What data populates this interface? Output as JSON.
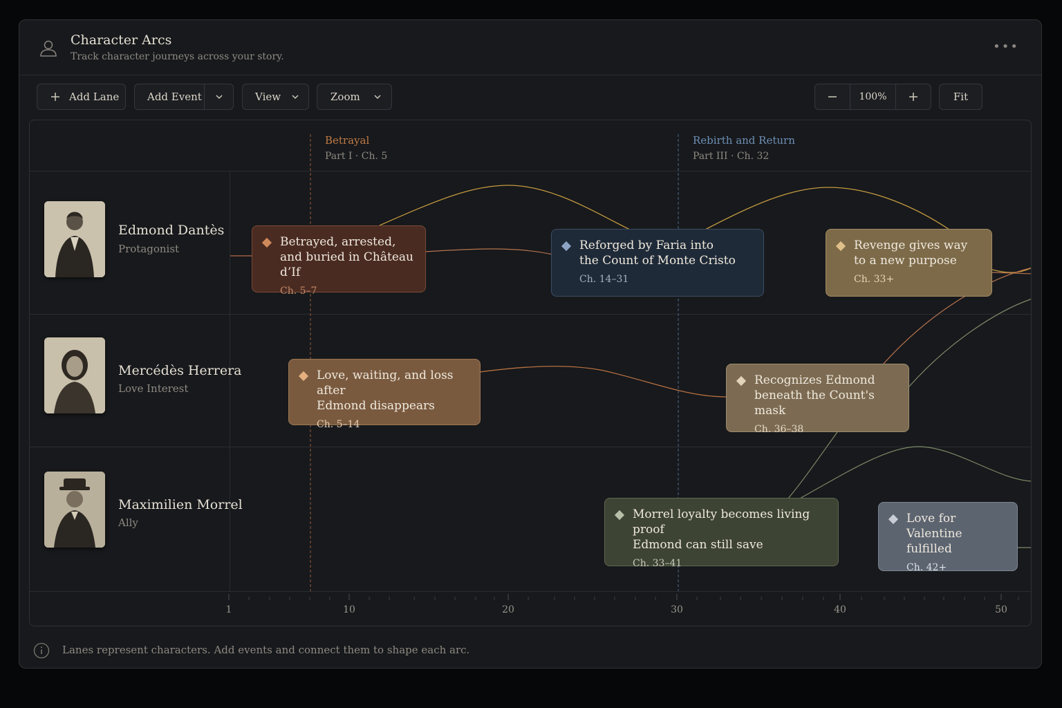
{
  "header": {
    "title": "Character Arcs",
    "subtitle": "Track character journeys across your story.",
    "more_icon": "more-horizontal-icon"
  },
  "toolbar": {
    "add_lane": "Add Lane",
    "add_event": "Add Event",
    "view": "View",
    "zoom": "Zoom",
    "zoom_level": "100%",
    "fit": "Fit"
  },
  "milestones": [
    {
      "title": "Betrayal",
      "subtitle": "Part I · Ch. 5",
      "chapter": 5,
      "color": "#c07a45"
    },
    {
      "title": "Rebirth and Return",
      "subtitle": "Part III · Ch. 32",
      "chapter": 32,
      "color": "#6f8fb5"
    }
  ],
  "lanes": [
    {
      "name": "Edmond Dantès",
      "role": "Protagonist"
    },
    {
      "name": "Mercédès Herrera",
      "role": "Love Interest"
    },
    {
      "name": "Maximilien Morrel",
      "role": "Ally"
    }
  ],
  "events": [
    {
      "line1": "Betrayed, arrested,",
      "line2": "and buried in Château d’If",
      "chapters": "Ch. 5–7",
      "bg": "#4a2b22",
      "border": "#7a4a36",
      "diamond": "#d08a5a",
      "chcolor": "#c58a66"
    },
    {
      "line1": "Reforged by Faria into",
      "line2": "the Count of Monte Cristo",
      "chapters": "Ch. 14–31",
      "bg": "#1f2a38",
      "border": "#3c4d63",
      "diamond": "#8ea4c4",
      "chcolor": "#a6b0bf"
    },
    {
      "line1": "Revenge gives way",
      "line2": "to a new purpose",
      "chapters": "Ch. 33+",
      "bg": "#7d6a49",
      "border": "#a38c62",
      "diamond": "#e0c08a",
      "chcolor": "#e6d6b8"
    },
    {
      "line1": "Love, waiting, and loss after",
      "line2": "Edmond disappears",
      "chapters": "Ch. 5–14",
      "bg": "#7a5a3f",
      "border": "#9d7853",
      "diamond": "#e3b07e",
      "chcolor": "#e4cdb3"
    },
    {
      "line1": "Recognizes Edmond",
      "line2": "beneath the Count's mask",
      "chapters": "Ch. 36–38",
      "bg": "#7c6b52",
      "border": "#a08d6e",
      "diamond": "#e2d3bb",
      "chcolor": "#e4d9c7"
    },
    {
      "line1": "Morrel loyalty becomes living proof",
      "line2": "Edmond can still save",
      "chapters": "Ch. 33–41",
      "bg": "#3e4434",
      "border": "#5f6750",
      "diamond": "#b8bfa9",
      "chcolor": "#c8ccbd"
    },
    {
      "line1": "Love for Valentine",
      "line2": "fulfilled",
      "chapters": "Ch. 42+",
      "bg": "#5c6470",
      "border": "#7d8694",
      "diamond": "#c7ccd5",
      "chcolor": "#dde1e7"
    }
  ],
  "axis": {
    "ticks": [
      "1",
      "10",
      "20",
      "30",
      "40",
      "50"
    ]
  },
  "footer": {
    "text": "Lanes represent characters. Add events and connect them to shape each arc.",
    "icon": "info-icon"
  }
}
